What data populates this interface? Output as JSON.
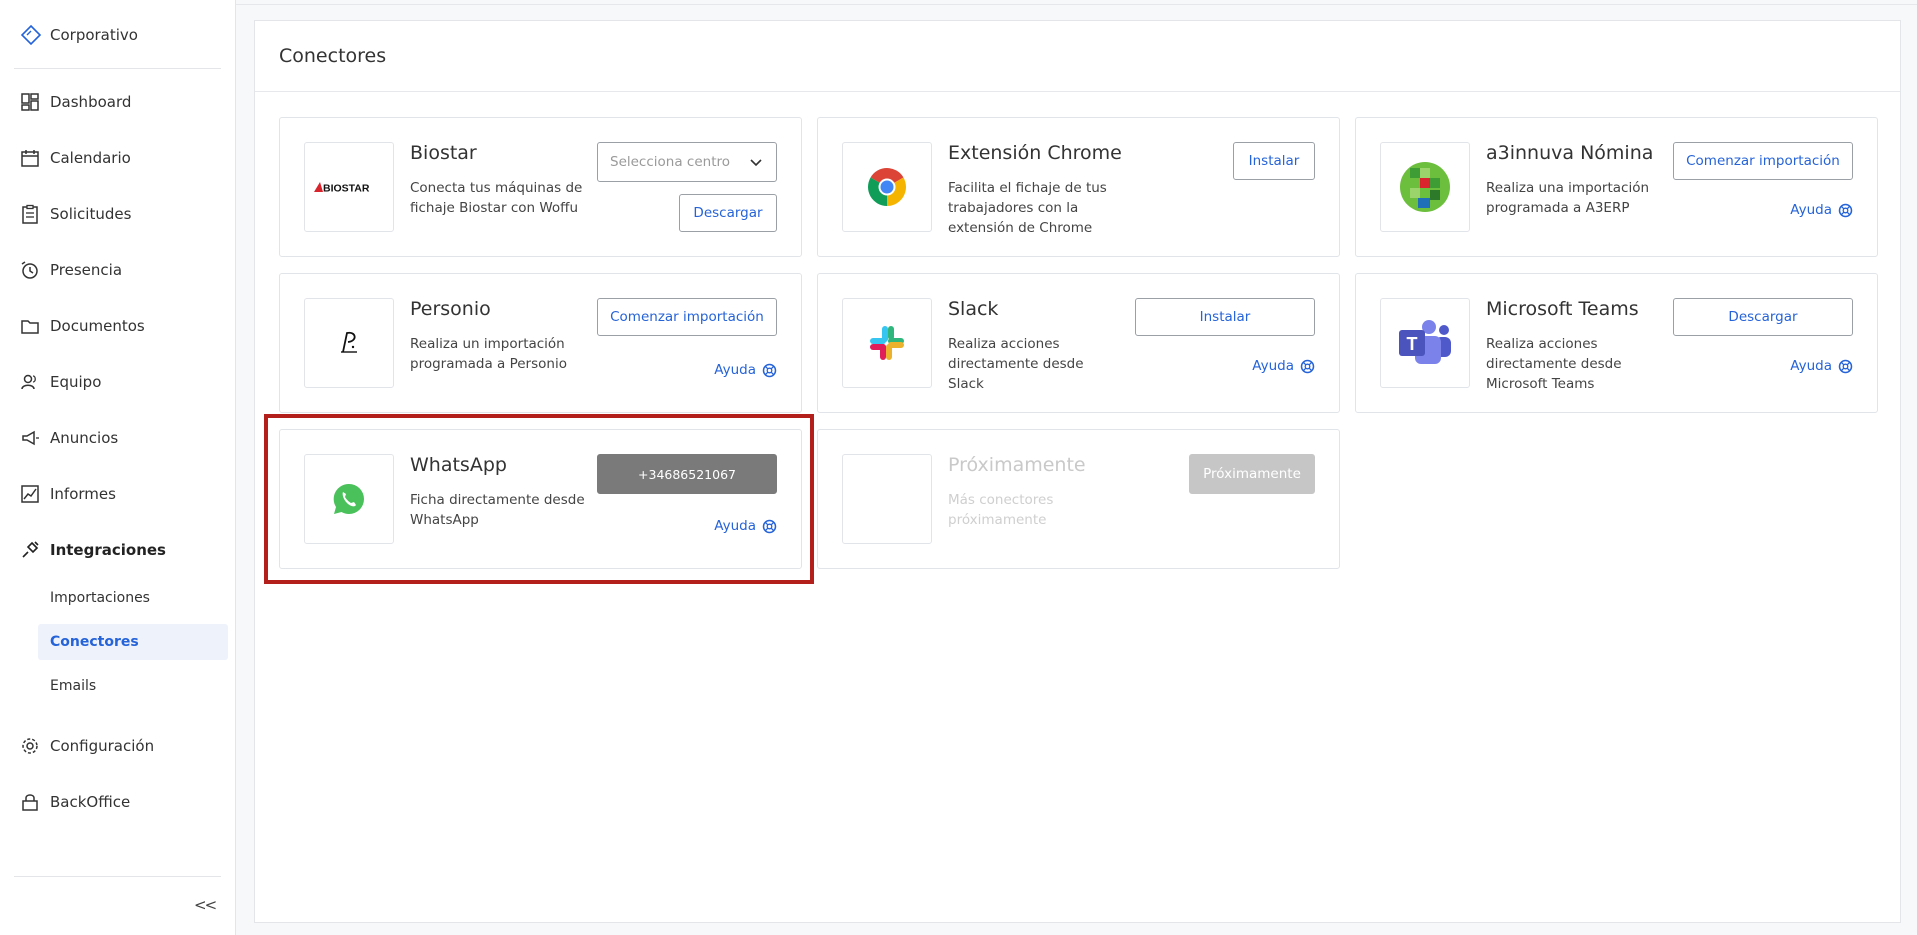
{
  "sidebar": {
    "brand": "Corporativo",
    "items": [
      {
        "label": "Dashboard",
        "icon": "dashboard-icon"
      },
      {
        "label": "Calendario",
        "icon": "calendar-icon"
      },
      {
        "label": "Solicitudes",
        "icon": "clipboard-icon"
      },
      {
        "label": "Presencia",
        "icon": "alarm-clock-icon"
      },
      {
        "label": "Documentos",
        "icon": "folder-icon"
      },
      {
        "label": "Equipo",
        "icon": "team-icon"
      },
      {
        "label": "Anuncios",
        "icon": "megaphone-icon"
      },
      {
        "label": "Informes",
        "icon": "chart-line-icon"
      },
      {
        "label": "Integraciones",
        "icon": "plug-icon"
      }
    ],
    "subitems": [
      {
        "label": "Importaciones"
      },
      {
        "label": "Conectores"
      },
      {
        "label": "Emails"
      }
    ],
    "bottom_items": [
      {
        "label": "Configuración",
        "icon": "gear-icon"
      },
      {
        "label": "BackOffice",
        "icon": "lock-icon"
      }
    ],
    "collapse_label": "<<"
  },
  "main": {
    "title": "Conectores",
    "cards": [
      {
        "title": "Biostar",
        "desc": "Conecta tus máquinas de fichaje Biostar con Woffu",
        "select_placeholder": "Selecciona centro",
        "button": "Descargar",
        "logo_text": "BIOSTAR"
      },
      {
        "title": "Extensión Chrome",
        "desc": "Facilita el fichaje de tus trabajadores con la extensión de Chrome",
        "button": "Instalar"
      },
      {
        "title": "a3innuva Nómina",
        "desc": "Realiza una importación programada a A3ERP",
        "button": "Comenzar importación",
        "help": "Ayuda"
      },
      {
        "title": "Personio",
        "desc": "Realiza un importación programada a Personio",
        "button": "Comenzar importación",
        "help": "Ayuda"
      },
      {
        "title": "Slack",
        "desc": "Realiza acciones directamente desde Slack",
        "button": "Instalar",
        "help": "Ayuda"
      },
      {
        "title": "Microsoft Teams",
        "desc": "Realiza acciones directamente desde Microsoft Teams",
        "button": "Descargar",
        "help": "Ayuda"
      },
      {
        "title": "WhatsApp",
        "desc": "Ficha directamente desde WhatsApp",
        "button": "+34686521067",
        "help": "Ayuda"
      },
      {
        "title": "Próximamente",
        "desc": "Más conectores próximamente",
        "button": "Próximamente"
      }
    ]
  },
  "colors": {
    "accent": "#2563d8",
    "highlight": "#b3201c"
  }
}
